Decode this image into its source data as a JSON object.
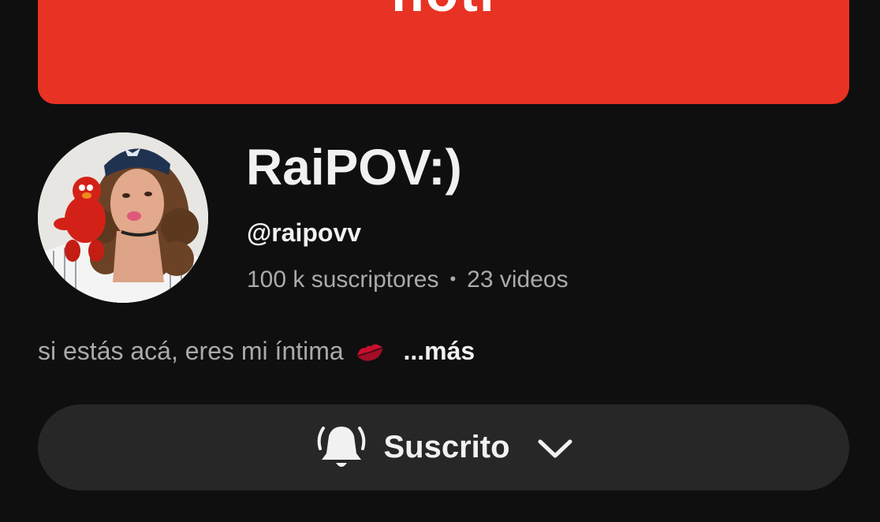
{
  "banner": {
    "text": "noti"
  },
  "channel": {
    "name": "RaiPOV:)",
    "handle": "@raipovv",
    "subscribers": "100 k suscriptores",
    "separator": "•",
    "videos": "23 videos",
    "description": "si estás acá, eres mi íntima",
    "more_label": "...más"
  },
  "subscribe": {
    "label": "Suscrito"
  },
  "colors": {
    "background": "#0f0f0f",
    "banner": "#e83223",
    "button": "#272727",
    "text_primary": "#f1f1f1",
    "text_secondary": "#aaaaaa"
  },
  "icons": {
    "notification": "bell-icon",
    "dropdown": "chevron-down-icon",
    "emoji": "kiss-mark-icon"
  }
}
